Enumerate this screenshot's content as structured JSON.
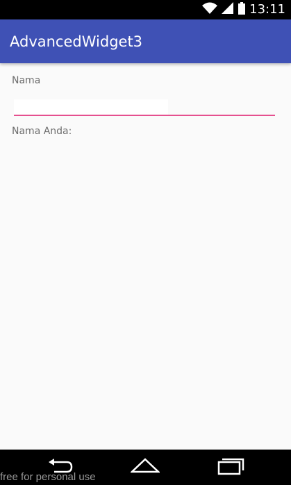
{
  "status_bar": {
    "time": "13:11"
  },
  "app_bar": {
    "title": "AdvancedWidget3"
  },
  "form": {
    "name_label": "Nama",
    "name_value": "",
    "output_label": "Nama Anda:"
  },
  "watermark": "free for personal use",
  "colors": {
    "primary": "#3f51b5",
    "accent": "#e5508f",
    "background": "#fafafa"
  }
}
